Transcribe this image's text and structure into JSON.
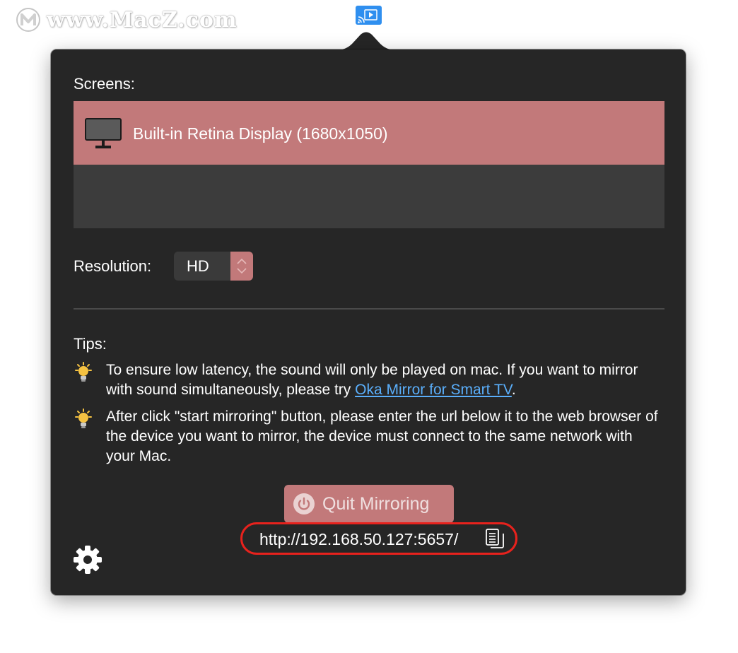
{
  "watermark": {
    "text": "www.MacZ.com"
  },
  "popover": {
    "screens_label": "Screens:",
    "screens": [
      {
        "name": "Built-in Retina Display (1680x1050)",
        "icon": "monitor-icon",
        "selected": true
      }
    ],
    "resolution_label": "Resolution:",
    "resolution_value": "HD",
    "tips_label": "Tips:",
    "tips": [
      {
        "text_before": "To ensure low latency, the sound will only be played on mac. If you want to mirror with sound simultaneously, please try ",
        "link": "Oka Mirror for Smart TV",
        "text_after": "."
      },
      {
        "text": "After click \"start mirroring\" button, please enter the url below it to the web browser of the device you want to mirror, the device must connect to the same network with your Mac."
      }
    ],
    "quit_button": "Quit Mirroring",
    "url": "http://192.168.50.127:5657/"
  },
  "colors": {
    "popover_bg": "#262626",
    "accent": "#c2797a",
    "link": "#5aaefa",
    "highlight_ring": "#e8221d",
    "menubar_icon": "#2f8fef",
    "bulb": "#f5c242"
  }
}
